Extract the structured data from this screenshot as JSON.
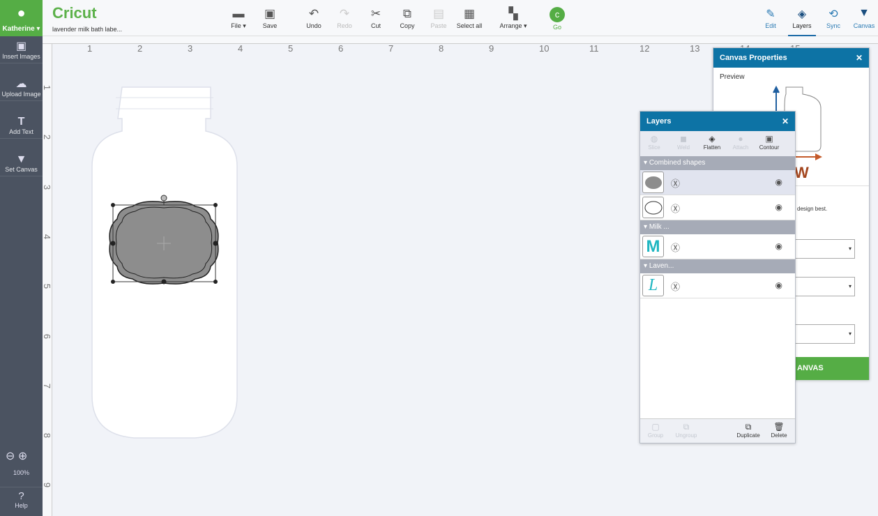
{
  "user": {
    "name": "Katherine",
    "icon": "user-icon"
  },
  "app": {
    "logo": "Cricut",
    "project_title": "lavender milk bath labe..."
  },
  "sidebar": [
    {
      "label": "Insert Images",
      "icon": "image-icon"
    },
    {
      "label": "Upload Image",
      "icon": "upload-icon"
    },
    {
      "label": "Add Text",
      "icon": "text-icon"
    },
    {
      "label": "Set Canvas",
      "icon": "shirt-icon"
    }
  ],
  "zoom": {
    "level": "100%"
  },
  "help": "Help",
  "toolbar": {
    "file": "File",
    "save": "Save",
    "undo": "Undo",
    "redo": "Redo",
    "cut": "Cut",
    "copy": "Copy",
    "paste": "Paste",
    "select_all": "Select all",
    "arrange": "Arrange",
    "go": "Go"
  },
  "tabs": {
    "edit": "Edit",
    "layers": "Layers",
    "sync": "Sync",
    "canvas": "Canvas",
    "active": "Layers"
  },
  "ruler": {
    "h": [
      "1",
      "2",
      "3",
      "4",
      "5",
      "6",
      "7",
      "8",
      "9",
      "10",
      "11",
      "12",
      "13",
      "14",
      "15"
    ],
    "v": [
      "1",
      "2",
      "3",
      "4",
      "5",
      "6",
      "7",
      "8",
      "9"
    ]
  },
  "canvas_props": {
    "title": "Canvas Properties",
    "preview": "Preview",
    "hint": "design best.",
    "button": "ANVAS"
  },
  "layers": {
    "title": "Layers",
    "tools": {
      "slice": "Slice",
      "weld": "Weld",
      "flatten": "Flatten",
      "attach": "Attach",
      "contour": "Contour"
    },
    "groups": [
      {
        "name": "Combined shapes"
      },
      {
        "name": "Milk ..."
      },
      {
        "name": "Laven..."
      }
    ],
    "letters": {
      "milk": "M",
      "lavender": "L"
    },
    "footer": {
      "group": "Group",
      "ungroup": "Ungroup",
      "duplicate": "Duplicate",
      "delete": "Delete"
    }
  },
  "colors": {
    "green": "#55ad45",
    "blue": "#0d73a5",
    "teal": "#1fb6c1",
    "sidebar": "#4b5361"
  }
}
